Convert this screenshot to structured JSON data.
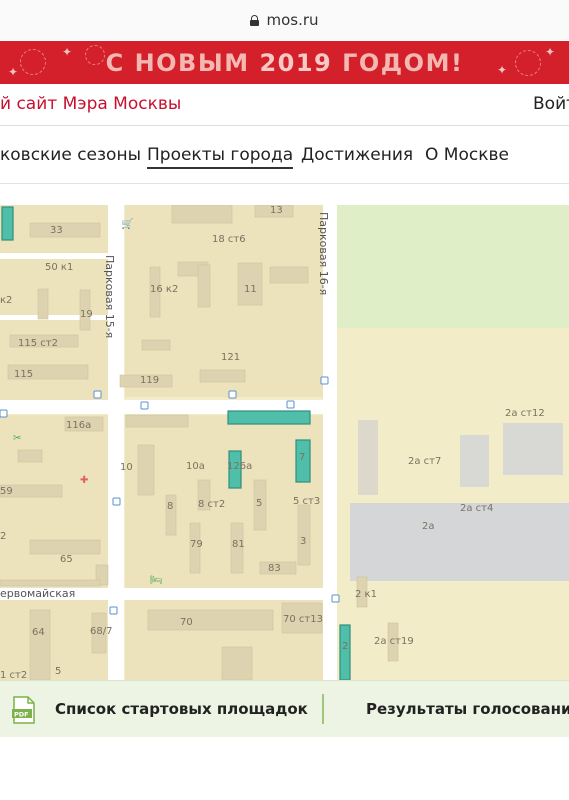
{
  "browser": {
    "domain": "mos.ru"
  },
  "banner": {
    "text_before": "С НОВЫМ ",
    "year": "2019",
    "text_after": " ГОДОМ!"
  },
  "header": {
    "site_title": "й сайт Мэра Москвы",
    "login": "Войти"
  },
  "nav": {
    "items": [
      {
        "label": "ковские сезоны"
      },
      {
        "label": "Проекты города",
        "active": true
      },
      {
        "label": "Достижения"
      },
      {
        "label": "О Москве"
      }
    ]
  },
  "map": {
    "street_labels": [
      "Парковая 15-я",
      "Парковая 16-я",
      "ервомайская"
    ],
    "building_labels": [
      "33",
      "13",
      "18 ст6",
      "50 к1",
      "16 к2",
      "11",
      "к2",
      "19",
      "115 ст2",
      "121",
      "115",
      "119",
      "116а",
      "2а ст12",
      "10",
      "10а",
      "126а",
      "7",
      "2а ст7",
      "59",
      "8",
      "8 ст2",
      "5",
      "5 ст3",
      "2а ст4",
      "2а",
      "2",
      "65",
      "79",
      "81",
      "3",
      "83",
      "2 к1",
      "64",
      "68/7",
      "70",
      "70 ст13",
      "2а ст19",
      "5",
      "1 ст2",
      "2"
    ],
    "colors": {
      "land": "#f3ecc9",
      "block": "#ece2bc",
      "building": "#ddd3b0",
      "road": "#ffffff",
      "park": "#dfeec6",
      "highlight": "#4fbfaa",
      "highlight_border": "#2f8e7c",
      "industrial": "#d4d6d8"
    }
  },
  "bottom_bar": {
    "pdf_label": "PDF",
    "list_label": "Список стартовых площадок",
    "results_label": "Результаты голосования"
  }
}
